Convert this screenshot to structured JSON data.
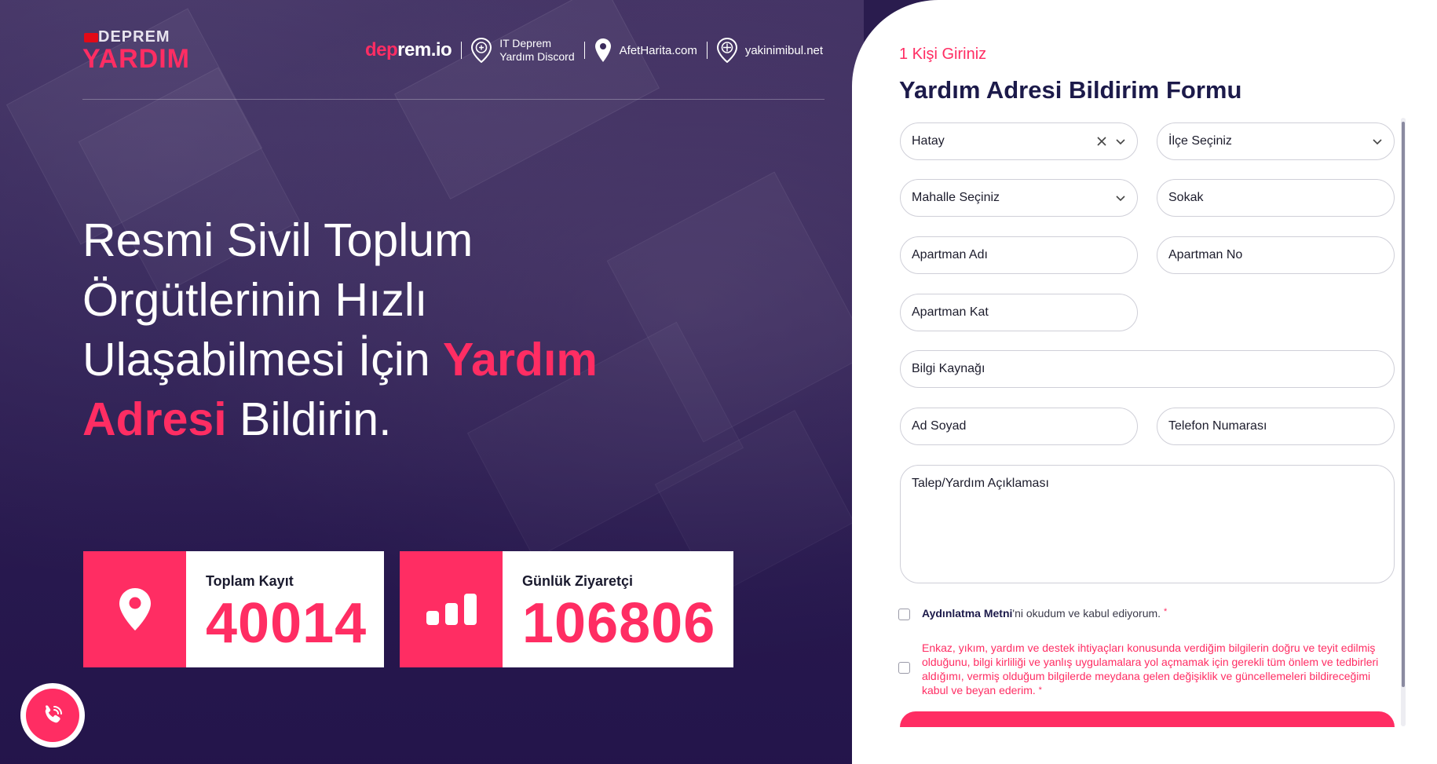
{
  "logo": {
    "top": "DEPREM",
    "bottom": "YARDIM"
  },
  "nav": {
    "deprem_io": {
      "part1": "dep",
      "part2": "rem.io"
    },
    "discord": {
      "line1": "IT Deprem",
      "line2": "Yardım Discord"
    },
    "afet": "AfetHarita.com",
    "yakin": "yakinimibul.net",
    "icons": [
      "brain-pin-icon",
      "map-pin-icon",
      "compass-pin-icon"
    ]
  },
  "headline": {
    "l1": "Resmi Sivil Toplum",
    "l2": "Örgütlerinin Hızlı",
    "l3a": "Ulaşabilmesi İçin ",
    "l3b": "Yardım",
    "l4a": "Adresi",
    "l4b": " Bildirin."
  },
  "stats": [
    {
      "label": "Toplam Kayıt",
      "value": "40014",
      "icon": "location-pin-icon"
    },
    {
      "label": "Günlük Ziyaretçi",
      "value": "106806",
      "icon": "bar-chart-icon"
    }
  ],
  "form": {
    "eyebrow": "1 Kişi Giriniz",
    "title": "Yardım Adresi Bildirim Formu",
    "il": "Hatay",
    "ilce": "İlçe Seçiniz",
    "mahalle": "Mahalle Seçiniz",
    "sokak": "Sokak",
    "apartman_adi": "Apartman Adı",
    "apartman_no": "Apartman No",
    "apartman_kat": "Apartman Kat",
    "bilgi_kaynagi": "Bilgi Kaynağı",
    "ad_soyad": "Ad Soyad",
    "telefon": "Telefon Numarası",
    "aciklama": "Talep/Yardım Açıklaması",
    "consent1_bold": "Aydınlatma Metni",
    "consent1_rest": "'ni okudum ve kabul ediyorum.",
    "consent2": "Enkaz, yıkım, yardım ve destek ihtiyaçları konusunda verdiğim bilgilerin doğru ve teyit edilmiş olduğunu, bilgi kirliliği ve yanlış uygulamalara yol açmamak için gerekli tüm önlem ve tedbirleri aldığımı, vermiş olduğum bilgilerde meydana gelen değişiklik ve güncellemeleri bildireceğimi kabul ve beyan ederim.",
    "required_mark": "*"
  },
  "colors": {
    "accent": "#ff2d63",
    "navy": "#1c1a4a",
    "hero_bg": "#2a1c4e"
  }
}
